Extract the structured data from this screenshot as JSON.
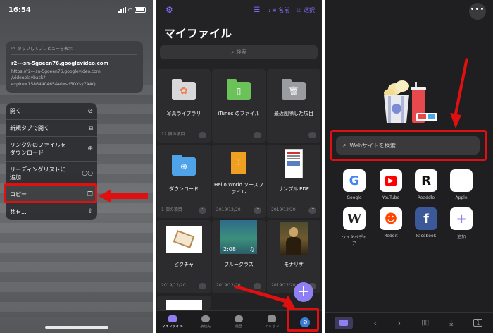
{
  "status": {
    "time": "16:54"
  },
  "preview": {
    "hint": "タップしてプレビューを表示",
    "url_title": "r2---sn-5goeen76.googlevideo.com",
    "url_lines": [
      "https://r2---sn-5goeen76.googlevideo.com",
      "/videoplayback?",
      "expire=1586440465&ei=sd5OXsy7AAQ..."
    ]
  },
  "context_menu": {
    "items": [
      {
        "label": "開く",
        "icon": "compass-icon"
      },
      {
        "label": "新規タブで開く",
        "icon": "new-tab-icon"
      },
      {
        "label": "リンク先のファイルを\nダウンロード",
        "icon": "download-icon"
      },
      {
        "label": "リーディングリストに\n追加",
        "icon": "glasses-icon"
      },
      {
        "label": "コピー",
        "icon": "copy-icon"
      },
      {
        "label": "共有...",
        "icon": "share-icon"
      }
    ]
  },
  "files": {
    "toolbar": {
      "sort_label": "名前",
      "select_label": "選択"
    },
    "title": "マイファイル",
    "search_placeholder": "検索",
    "items": [
      {
        "name": "写真ライブラリ",
        "meta": "12 個の項目"
      },
      {
        "name": "iTunes のファイル",
        "meta": ""
      },
      {
        "name": "最近削除した項目",
        "meta": ""
      },
      {
        "name": "ダウンロード",
        "meta": "1 個の項目"
      },
      {
        "name": "Hello World ソースファイル",
        "meta": "2019/12/20"
      },
      {
        "name": "サンプル PDF",
        "meta": "2019/12/20"
      },
      {
        "name": "ピクチャ",
        "meta": "2019/12/20"
      },
      {
        "name": "ブルーグラス",
        "meta": "2019/12/20",
        "duration": "2:08"
      },
      {
        "name": "モナリザ",
        "meta": "2019/12/20"
      }
    ],
    "fab": "+",
    "tabs": [
      {
        "label": "マイファイル",
        "icon": "folder-icon",
        "active": true
      },
      {
        "label": "接続先",
        "icon": "network-icon",
        "active": false
      },
      {
        "label": "履歴",
        "icon": "clock-icon",
        "active": false
      },
      {
        "label": "アドオン",
        "icon": "addon-icon",
        "active": false
      },
      {
        "label": "",
        "icon": "browser-compass-icon",
        "active": false
      }
    ]
  },
  "browser": {
    "more": "•••",
    "search_placeholder": "Webサイトを検索",
    "favorites": [
      {
        "label": "Google",
        "glyph": "G",
        "color": "#4285f4"
      },
      {
        "label": "YouTube",
        "glyph": "▶",
        "color": "#ff0000"
      },
      {
        "label": "Readdle",
        "glyph": "R",
        "color": "#e5202e"
      },
      {
        "label": "Apple",
        "glyph": "",
        "color": "#b5b5b5"
      },
      {
        "label": "ウィキペディア",
        "glyph": "W",
        "color": "#222222"
      },
      {
        "label": "Reddit",
        "glyph": "☻",
        "color": "#ff4500"
      },
      {
        "label": "Facebook",
        "glyph": "f",
        "color": "#ffffff"
      },
      {
        "label": "追加",
        "glyph": "+",
        "color": "#8f7ff5"
      }
    ],
    "bottom_bar": [
      "folder-icon",
      "back-icon",
      "forward-icon",
      "bookmarks-icon",
      "download-icon",
      "tabs-icon"
    ],
    "tabs_count": "1"
  }
}
